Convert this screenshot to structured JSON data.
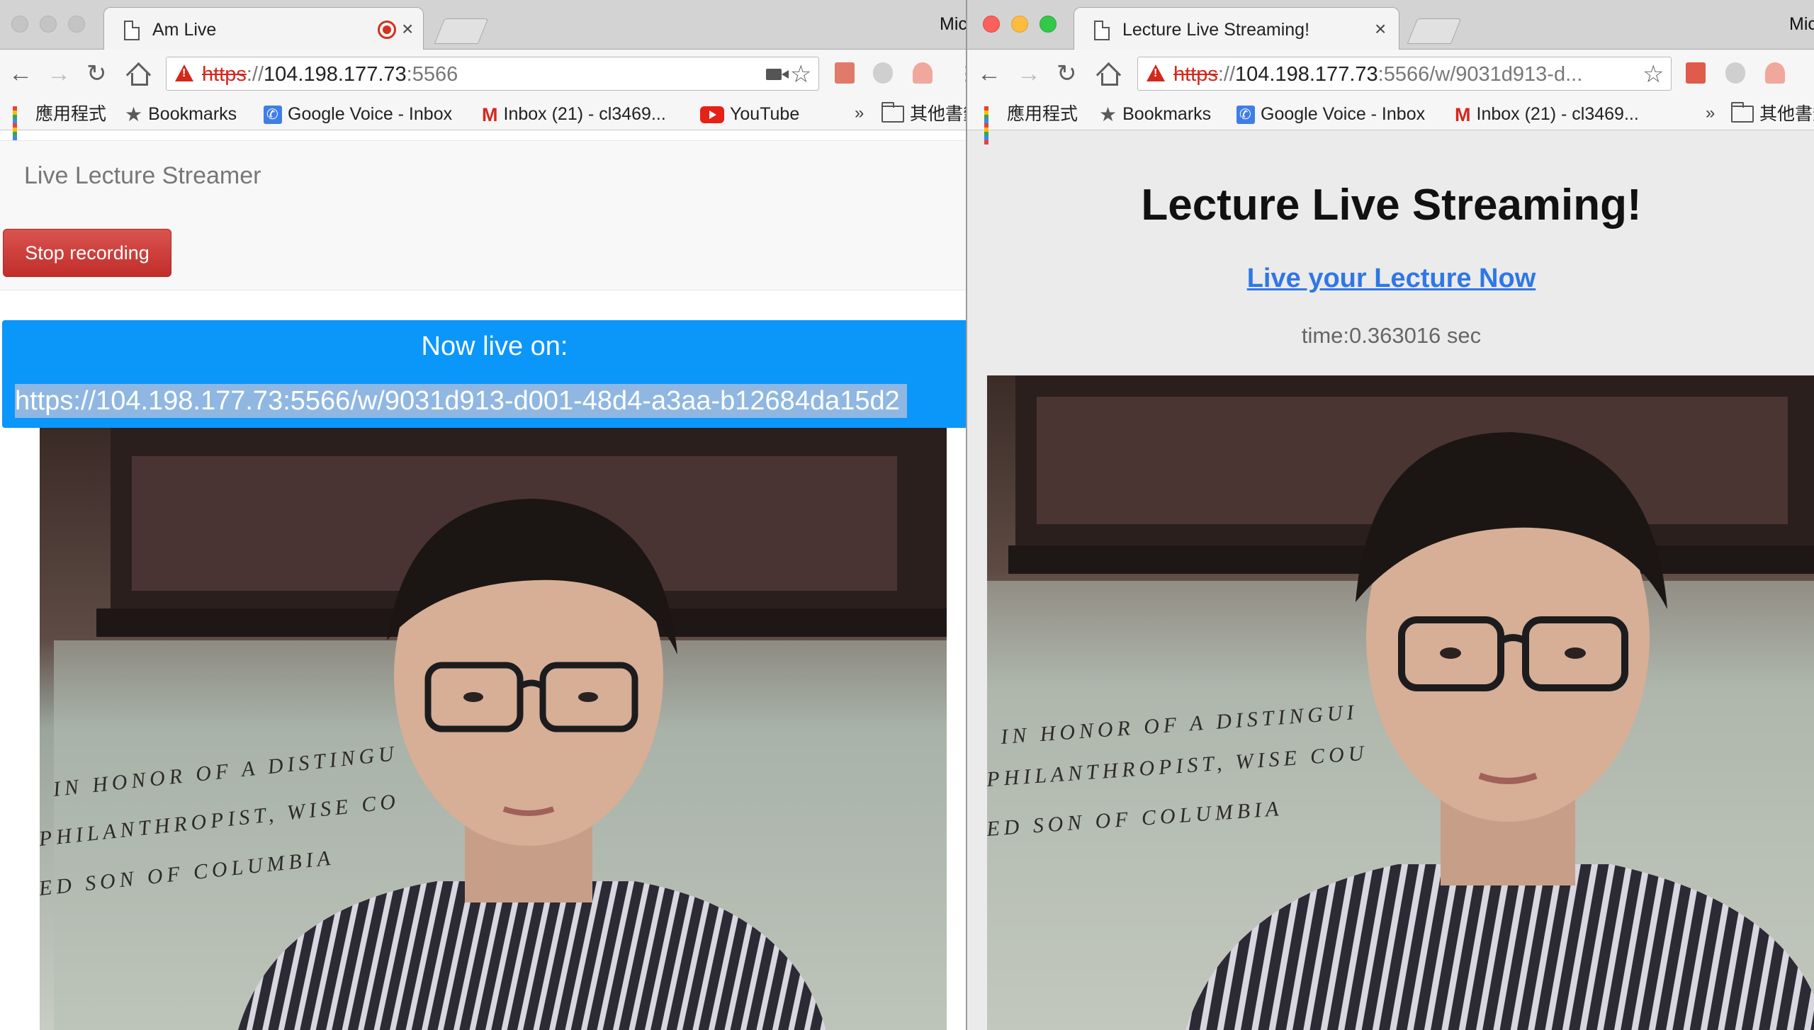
{
  "left_window": {
    "tab": {
      "title": "Am Live",
      "recording_icon": "recording-dot-icon",
      "close": "×"
    },
    "top_clip_text": "Mic",
    "toolbar": {
      "url_scheme": "https",
      "url_sep": "://",
      "url_host": "104.198.177.73",
      "url_rest": ":5566"
    },
    "bookmarks": [
      {
        "label": "應用程式",
        "icon": "apps-icon"
      },
      {
        "label": "Bookmarks",
        "icon": "star-icon"
      },
      {
        "label": "Google Voice - Inbox",
        "icon": "google-voice-icon"
      },
      {
        "label": "Inbox (21) - cl3469...",
        "icon": "gmail-icon"
      },
      {
        "label": "YouTube",
        "icon": "youtube-icon"
      }
    ],
    "bookmarks_overflow": "»",
    "other_bookmarks": "其他書籤",
    "page": {
      "brand": "Live Lecture Streamer",
      "stop_button": "Stop recording",
      "banner_title": "Now live on:",
      "live_link": "https://104.198.177.73:5566/w/9031d913-d001-48d4-a3aa-b12684da15d2"
    },
    "video": {
      "wall_text": [
        "IN HONOR OF A DISTINGU",
        "PHILANTHROPIST, WISE CO",
        "ED SON OF COLUMBIA"
      ]
    }
  },
  "right_window": {
    "tab": {
      "title": "Lecture Live Streaming!",
      "close": "×"
    },
    "top_clip_text": "Mic",
    "toolbar": {
      "url_scheme": "https",
      "url_sep": "://",
      "url_host": "104.198.177.73",
      "url_rest": ":5566/w/9031d913-d..."
    },
    "bookmarks": [
      {
        "label": "應用程式",
        "icon": "apps-icon"
      },
      {
        "label": "Bookmarks",
        "icon": "star-icon"
      },
      {
        "label": "Google Voice - Inbox",
        "icon": "google-voice-icon"
      },
      {
        "label": "Inbox (21) - cl3469...",
        "icon": "gmail-icon"
      }
    ],
    "bookmarks_overflow": "»",
    "other_bookmarks": "其他書籤",
    "page": {
      "title": "Lecture Live Streaming!",
      "live_link": "Live your Lecture Now",
      "time": "time:0.363016 sec"
    },
    "video": {
      "wall_text": [
        "IN HONOR OF A DISTINGUI",
        "PHILANTHROPIST, WISE COU",
        "ED SON OF COLUMBIA"
      ]
    }
  },
  "colors": {
    "banner_blue": "#0b96fa",
    "stop_red": "#d9534f",
    "link_blue": "#2f77e6",
    "insecure_red": "#d4281c"
  }
}
